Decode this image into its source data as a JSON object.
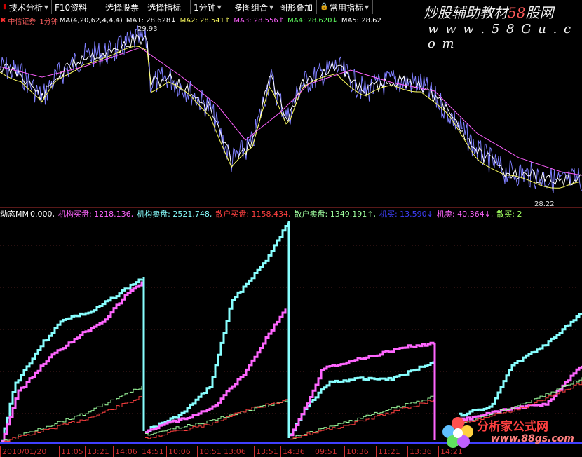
{
  "toolbar": {
    "items": [
      {
        "label": "技术分析",
        "arrow": true
      },
      {
        "label": "F10资料",
        "arrow": false
      },
      {
        "label": "选择股票",
        "arrow": false
      },
      {
        "label": "选择指标",
        "arrow": false
      },
      {
        "label": "1分钟",
        "arrow": true
      },
      {
        "label": "多图组合",
        "arrow": true
      },
      {
        "label": "图形叠加",
        "arrow": false
      },
      {
        "label": "常用指标",
        "arrow": true
      }
    ]
  },
  "watermark": {
    "text": "炒股辅助教材",
    "num": "58",
    "rest": "股网",
    "url": "w w w . 5 8 G u . c o m"
  },
  "price_panel": {
    "stock": "中信证券",
    "period": "1分钟",
    "ma_def": "MA(4,20,62,4,4,4)",
    "ma1": "MA1: 28.628↓",
    "ma2": "MA2: 28.541↑",
    "ma3": "MA3: 28.556↑",
    "ma4": "MA4: 28.620↓",
    "ma5": "MA5: 28.62",
    "high_label": "29.93",
    "low_label": "28.22"
  },
  "indicator_panel": {
    "name": "动态MM",
    "value": "0.000,",
    "jg_buy": "机构买盘: 1218.136,",
    "jg_sell": "机构卖盘: 2521.748,",
    "sh_buy": "散户买盘: 1158.434,",
    "sh_sell": "散户卖盘: 1349.191↑,",
    "jm": "机买: 13.590↓",
    "js": "机卖: 40.364↓,",
    "sm": "散买: 2"
  },
  "colors": {
    "jg_buy": "#ff66ff",
    "jg_sell": "#88ffff",
    "sh_buy": "#ff4040",
    "sh_sell": "#a0ffa0",
    "ma1": "#ffffff",
    "ma2": "#ffff60",
    "ma3": "#ff60ff",
    "ma4": "#60ff60",
    "ma5": "#ffffff",
    "price": "#7f7fff"
  },
  "time_axis": [
    "2010/01/20",
    "11:05",
    "13:21",
    "14:06",
    "14:51",
    "10:06",
    "10:51",
    "13:06",
    "13:51",
    "14:36",
    "09:51",
    "10:36",
    "11:21",
    "13:36",
    "14:21"
  ],
  "logo": {
    "title": "分析家公式网",
    "url": "www.88gs.com"
  },
  "chart_data": {
    "type": "line",
    "title": "中信证券",
    "price_series": {
      "name": "中信证券",
      "high": 29.93,
      "low": 28.22
    },
    "ma_values": {
      "MA1": 28.628,
      "MA2": 28.541,
      "MA3": 28.556,
      "MA4": 28.62
    },
    "indicator_series": [
      {
        "name": "机构买盘",
        "last": 1218.136
      },
      {
        "name": "机构卖盘",
        "last": 2521.748
      },
      {
        "name": "散户买盘",
        "last": 1158.434
      },
      {
        "name": "散户卖盘",
        "last": 1349.191
      }
    ]
  }
}
